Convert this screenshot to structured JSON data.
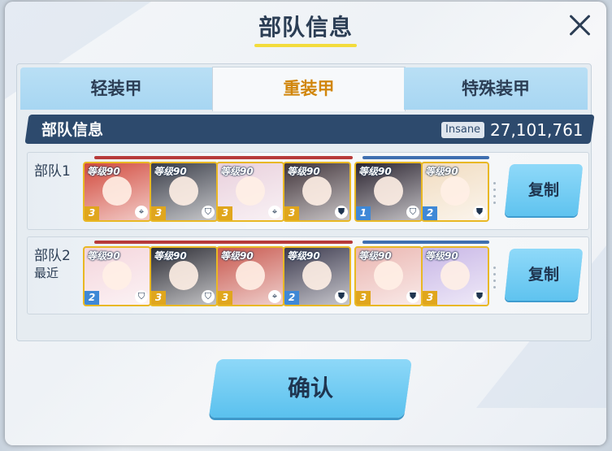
{
  "dialog": {
    "title": "部队信息",
    "close_icon": "close-icon"
  },
  "tabs": [
    {
      "label": "轻装甲",
      "selected": false
    },
    {
      "label": "重装甲",
      "selected": true
    },
    {
      "label": "特殊装甲",
      "selected": false
    }
  ],
  "info": {
    "label": "部队信息",
    "difficulty": "Insane",
    "power": "27,101,761"
  },
  "units": [
    {
      "label": "部队1",
      "sublabel": "",
      "copy_label": "复制",
      "cards": [
        {
          "level": "等级90",
          "stars": "3",
          "role_icon": "crosshair-icon",
          "bg": "#d24a3d"
        },
        {
          "level": "等级90",
          "stars": "3",
          "role_icon": "healer-icon",
          "bg": "#3a3d48"
        },
        {
          "level": "等级90",
          "stars": "3",
          "role_icon": "crosshair-icon",
          "bg": "#e9d0dc"
        },
        {
          "level": "等级90",
          "stars": "3",
          "role_icon": "shield-icon",
          "bg": "#41343a"
        },
        {
          "level": "等级90",
          "stars": "1",
          "role_icon": "healer-icon",
          "bg": "#2b2430"
        },
        {
          "level": "等级90",
          "stars": "2",
          "role_icon": "shield-icon",
          "bg": "#f1dcc0"
        }
      ]
    },
    {
      "label": "部队2",
      "sublabel": "最近",
      "copy_label": "复制",
      "cards": [
        {
          "level": "等级90",
          "stars": "2",
          "role_icon": "healer-icon",
          "bg": "#f4d5dc"
        },
        {
          "level": "等级90",
          "stars": "3",
          "role_icon": "healer-icon",
          "bg": "#2c2c34"
        },
        {
          "level": "等级90",
          "stars": "3",
          "role_icon": "crosshair-icon",
          "bg": "#c8584e"
        },
        {
          "level": "等级90",
          "stars": "2",
          "role_icon": "shield-icon",
          "bg": "#3c3a4e"
        },
        {
          "level": "等级90",
          "stars": "3",
          "role_icon": "shield-icon",
          "bg": "#eab5b0"
        },
        {
          "level": "等级90",
          "stars": "3",
          "role_icon": "shield-icon",
          "bg": "#c8b6e6"
        }
      ]
    }
  ],
  "confirm_label": "确认"
}
